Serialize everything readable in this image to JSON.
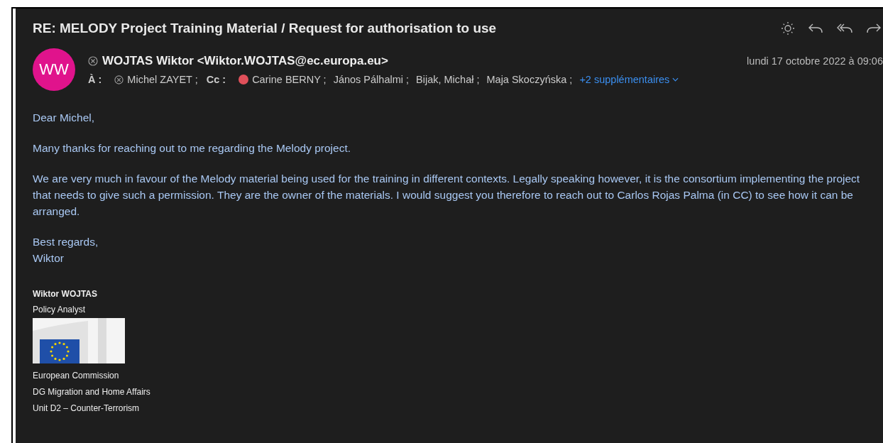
{
  "subject": "RE: MELODY Project Training Material / Request for authorisation to use",
  "sender": {
    "initials": "WW",
    "name": "WOJTAS Wiktor <Wiktor.WOJTAS@ec.europa.eu>",
    "date": "lundi 17 octobre 2022 à 09:06"
  },
  "to_label": "À :",
  "to": [
    {
      "name": "Michel ZAYET ;",
      "kind": "blocked"
    }
  ],
  "cc_label": "Cc :",
  "cc": [
    {
      "name": "Carine BERNY ;",
      "kind": "dot",
      "color": "#e0505a"
    },
    {
      "name": "János Pálhalmi ;",
      "kind": "plain"
    },
    {
      "name": "Bijak, Michał ;",
      "kind": "plain"
    },
    {
      "name": "Maja Skoczyńska ;",
      "kind": "plain"
    }
  ],
  "more_recipients": "+2 supplémentaires",
  "body": [
    "Dear Michel,",
    "Many thanks for reaching out to me regarding the Melody project.",
    "We are very much in favour of the Melody material being used for the training in different contexts. Legally speaking however, it is the consortium implementing the project that needs to give such a permission. They are the owner of the materials. I would suggest you therefore to reach out to Carlos Rojas Palma (in CC) to see how it can be arranged.",
    "Best regards,\nWiktor"
  ],
  "signature": {
    "name": "Wiktor WOJTAS",
    "role": "Policy Analyst",
    "lines": [
      "European Commission",
      "DG Migration and Home Affairs",
      "Unit D2 – Counter-Terrorism"
    ]
  }
}
